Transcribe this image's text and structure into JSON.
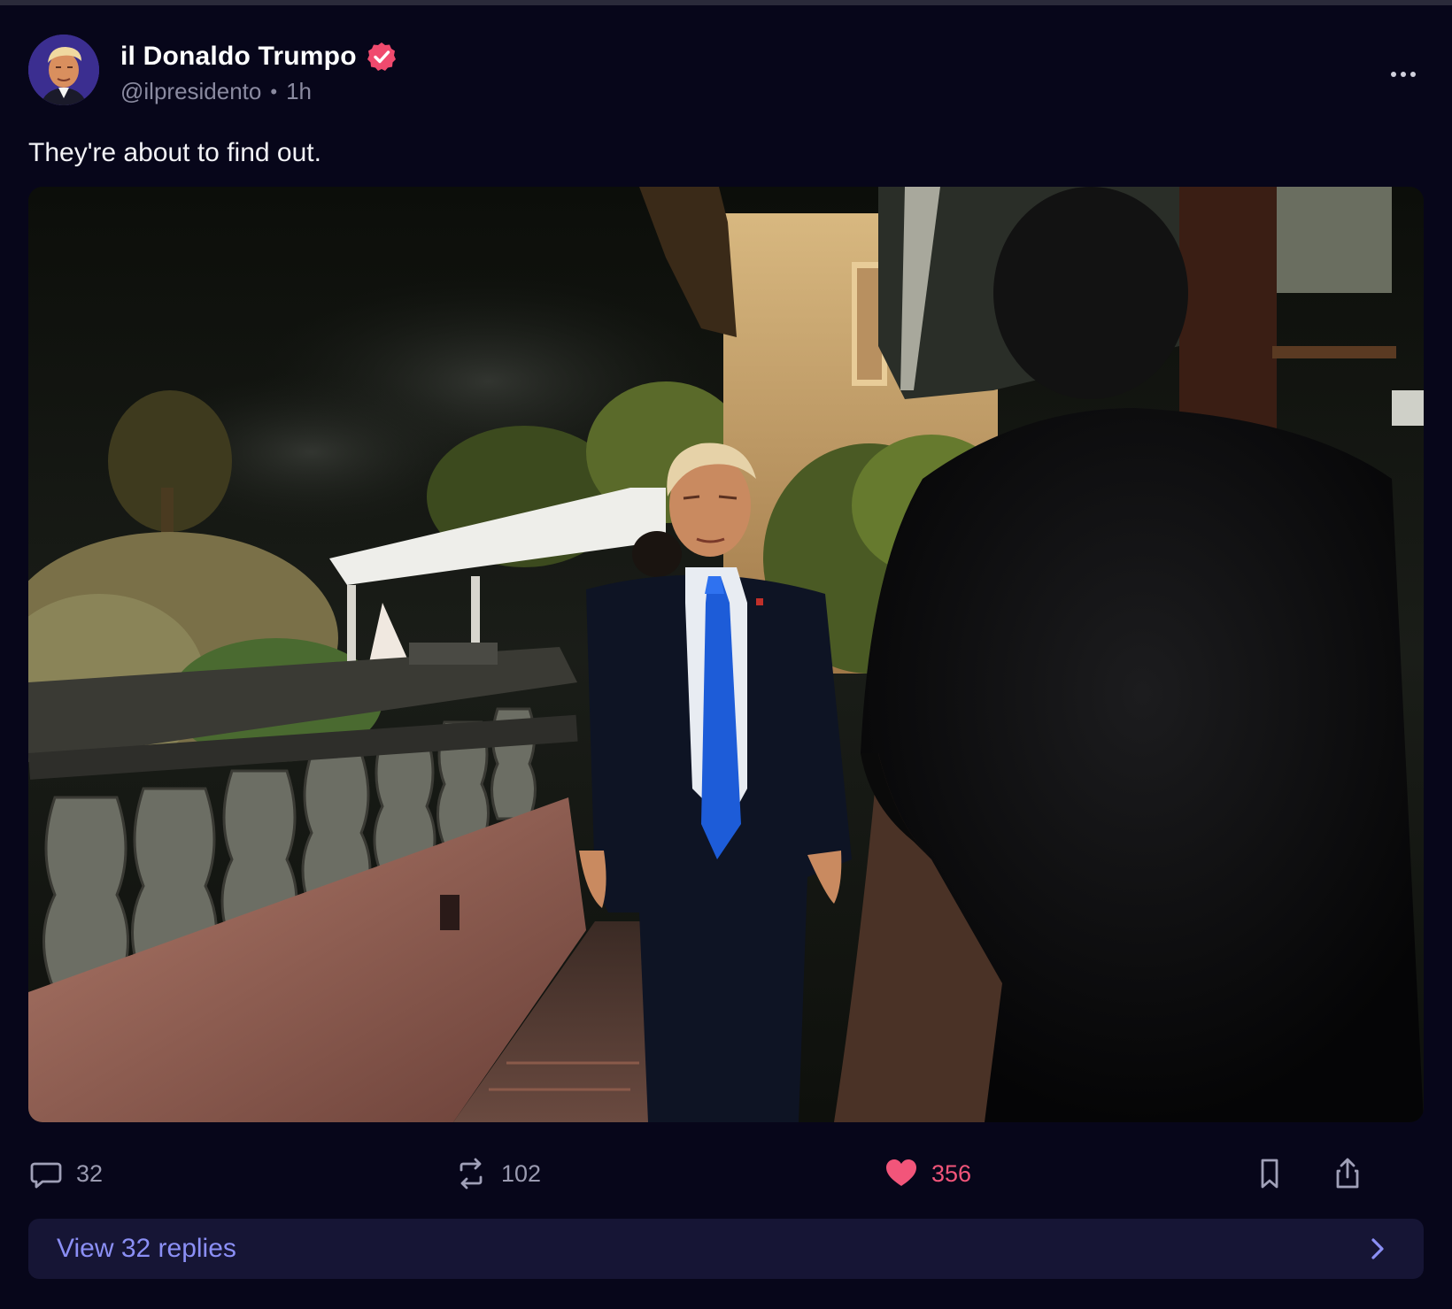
{
  "post": {
    "author": {
      "display_name": "il Donaldo Trumpo",
      "handle": "@ilpresidento",
      "verified": true,
      "avatar_icon": "avatar-photo"
    },
    "timestamp": "1h",
    "separator": "•",
    "text": "They're about to find out.",
    "media": {
      "type": "photo"
    },
    "actions": {
      "replies": {
        "icon": "comment-icon",
        "count": "32"
      },
      "reposts": {
        "icon": "repost-icon",
        "count": "102"
      },
      "likes": {
        "icon": "heart-icon",
        "count": "356",
        "liked": true
      },
      "bookmark": {
        "icon": "bookmark-icon"
      },
      "share": {
        "icon": "share-icon"
      }
    },
    "view_replies_label": "View 32 replies",
    "more_icon": "more-horizontal-icon"
  },
  "colors": {
    "background": "#07061a",
    "text_primary": "#ffffff",
    "text_secondary": "#8a8aa0",
    "accent_pink": "#f2557a",
    "accent_blue": "#8b8ff5",
    "panel": "#161535"
  }
}
